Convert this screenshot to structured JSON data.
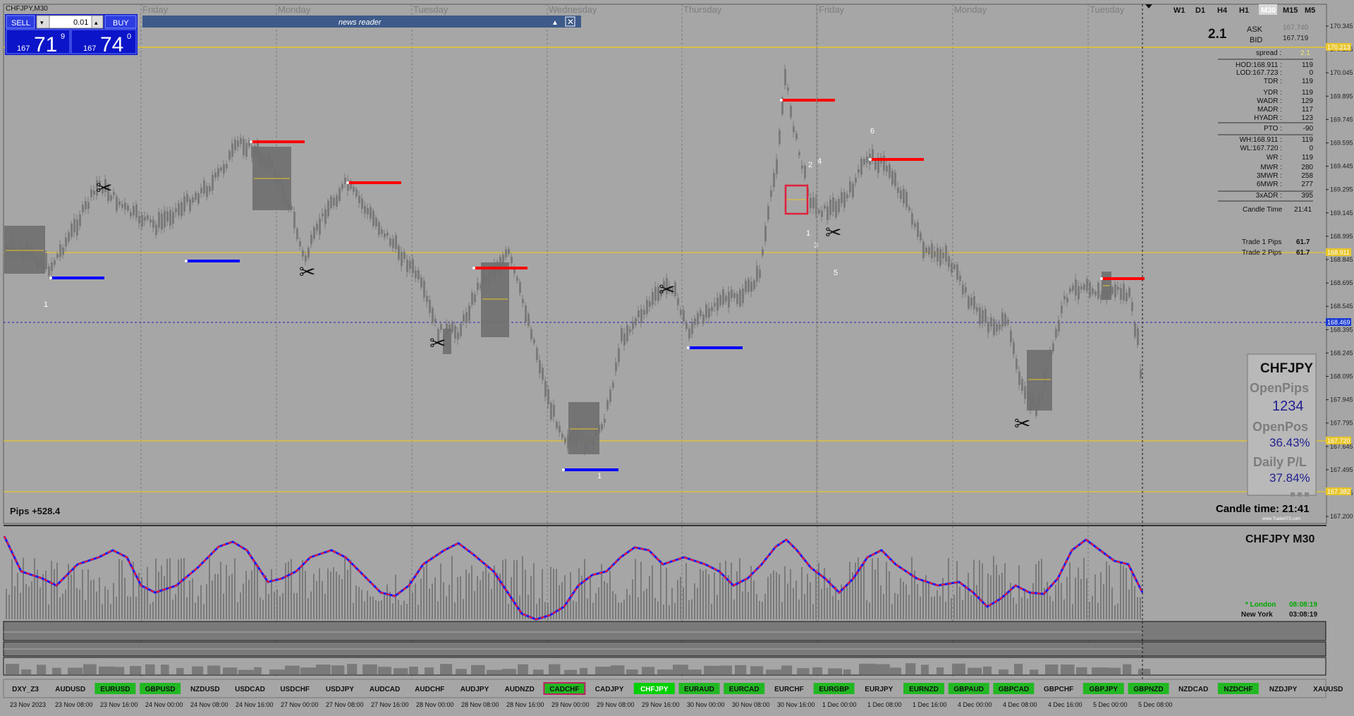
{
  "window": {
    "title": "CHFJPY,M30"
  },
  "trade_panel": {
    "sell_label": "SELL",
    "buy_label": "BUY",
    "lot_value": "0.01",
    "sell_price": {
      "prefix": "167",
      "big": "71",
      "sup": "9"
    },
    "buy_price": {
      "prefix": "167",
      "big": "74",
      "sup": "0"
    }
  },
  "news_reader": {
    "title": "news reader"
  },
  "day_labels": [
    "Friday",
    "Monday",
    "Tuesday",
    "Wednesday",
    "Thursday",
    "Friday",
    "Monday",
    "Tuesday"
  ],
  "timeframes": [
    "W1",
    "D1",
    "H4",
    "H1",
    "M30",
    "M15",
    "M5"
  ],
  "active_timeframe": "M30",
  "info": {
    "spread_value": "2.1",
    "ask_label": "ASK",
    "ask_value": "167.740",
    "bid_label": "BID",
    "bid_value": "167.719",
    "spread_label": "spread :",
    "spread_small": "2.1",
    "rows": [
      {
        "label": "HOD:168.911 :",
        "value": "119"
      },
      {
        "label": "LOD:167.723 :",
        "value": "0"
      },
      {
        "label": "TDR :",
        "value": "119"
      },
      {
        "label": "YDR :",
        "value": "119"
      },
      {
        "label": "WADR :",
        "value": "129"
      },
      {
        "label": "MADR :",
        "value": "117"
      },
      {
        "label": "HYADR :",
        "value": "123"
      },
      {
        "label": "PTO :",
        "value": "-90"
      },
      {
        "label": "WH:168.911 :",
        "value": "119"
      },
      {
        "label": "WL:167.720 :",
        "value": "0"
      },
      {
        "label": "WR :",
        "value": "119"
      },
      {
        "label": "MWR :",
        "value": "280"
      },
      {
        "label": "3MWR :",
        "value": "258"
      },
      {
        "label": "6MWR :",
        "value": "277"
      },
      {
        "label": "3xADR :",
        "value": "395"
      }
    ],
    "candle_time_label": "Candle Time",
    "candle_time_value": "21:41",
    "trade1_label": "Trade 1 Pips",
    "trade1_value": "61.7",
    "trade2_label": "Trade 2 Pips",
    "trade2_value": "61.7"
  },
  "price_axis": [
    "170.345",
    "170.195",
    "170.045",
    "169.895",
    "169.745",
    "169.595",
    "169.445",
    "169.295",
    "169.145",
    "168.995",
    "168.845",
    "168.695",
    "168.545",
    "168.395",
    "168.245",
    "168.095",
    "167.945",
    "167.795",
    "167.645",
    "167.495",
    "167.345",
    "167.200"
  ],
  "price_tags": {
    "top": "170.213",
    "upper": "168.911",
    "current": "168.469",
    "lower": "167.720",
    "bottom": "167.382"
  },
  "stats_box": {
    "symbol": "CHFJPY",
    "open_pips_label": "OpenPips",
    "open_pips_value": "1234",
    "open_pos_label": "OpenPos",
    "open_pos_value": "36.43%",
    "daily_pl_label": "Daily P/L",
    "daily_pl_value": "37.84%",
    "footer": "www.TradeATS.com"
  },
  "pips_total": "Pips +528.4",
  "candle_time_big": "Candle time:  21:41",
  "chart_markers": {
    "n1a": "1",
    "n1b": "1",
    "n1c": "1",
    "n2": "2",
    "n3": "3",
    "n4": "4",
    "n5": "5",
    "n6": "6"
  },
  "sub_chart": {
    "label": "CHFJPY  M30",
    "london_label": "* London",
    "london_time": "08:08:19",
    "newyork_label": "New York",
    "newyork_time": "03:08:19"
  },
  "symbol_bar": [
    {
      "name": "DXY_Z3",
      "style": "plain"
    },
    {
      "name": "AUDUSD",
      "style": "plain"
    },
    {
      "name": "EURUSD",
      "style": "green"
    },
    {
      "name": "GBPUSD",
      "style": "green"
    },
    {
      "name": "NZDUSD",
      "style": "plain"
    },
    {
      "name": "USDCAD",
      "style": "plain"
    },
    {
      "name": "USDCHF",
      "style": "plain"
    },
    {
      "name": "USDJPY",
      "style": "plain"
    },
    {
      "name": "AUDCAD",
      "style": "plain"
    },
    {
      "name": "AUDCHF",
      "style": "plain"
    },
    {
      "name": "AUDJPY",
      "style": "plain"
    },
    {
      "name": "AUDNZD",
      "style": "plain"
    },
    {
      "name": "CADCHF",
      "style": "green-outline"
    },
    {
      "name": "CADJPY",
      "style": "plain"
    },
    {
      "name": "CHFJPY",
      "style": "bright"
    },
    {
      "name": "EURAUD",
      "style": "green"
    },
    {
      "name": "EURCAD",
      "style": "green"
    },
    {
      "name": "EURCHF",
      "style": "plain"
    },
    {
      "name": "EURGBP",
      "style": "green"
    },
    {
      "name": "EURJPY",
      "style": "plain"
    },
    {
      "name": "EURNZD",
      "style": "green"
    },
    {
      "name": "GBPAUD",
      "style": "green"
    },
    {
      "name": "GBPCAD",
      "style": "green"
    },
    {
      "name": "GBPCHF",
      "style": "plain"
    },
    {
      "name": "GBPJPY",
      "style": "green"
    },
    {
      "name": "GBPNZD",
      "style": "green"
    },
    {
      "name": "NZDCAD",
      "style": "plain"
    },
    {
      "name": "NZDCHF",
      "style": "green"
    },
    {
      "name": "NZDJPY",
      "style": "plain"
    },
    {
      "name": "XAUUSD",
      "style": "plain"
    }
  ],
  "time_axis": [
    "23 Nov 2023",
    "23 Nov 08:00",
    "23 Nov 16:00",
    "24 Nov 00:00",
    "24 Nov 08:00",
    "24 Nov 16:00",
    "27 Nov 00:00",
    "27 Nov 08:00",
    "27 Nov 16:00",
    "28 Nov 00:00",
    "28 Nov 08:00",
    "28 Nov 16:00",
    "29 Nov 00:00",
    "29 Nov 08:00",
    "29 Nov 16:00",
    "30 Nov 00:00",
    "30 Nov 08:00",
    "30 Nov 16:00",
    "1 Dec 00:00",
    "1 Dec 08:00",
    "1 Dec 16:00",
    "4 Dec 00:00",
    "4 Dec 08:00",
    "4 Dec 16:00",
    "5 Dec 00:00",
    "5 Dec 08:00"
  ],
  "colors": {
    "background": "#a6a6a6",
    "candles": "#7a7a7a",
    "level_line": "#e8c52a",
    "current_price_line": "#2020c0",
    "resistance": "#ff0000",
    "support": "#0000ff",
    "panel_blue": "#0b14c8",
    "oscillator_up": "#1a1aff",
    "oscillator_down": "#ff1a1a",
    "active_symbol": "#00d000"
  }
}
